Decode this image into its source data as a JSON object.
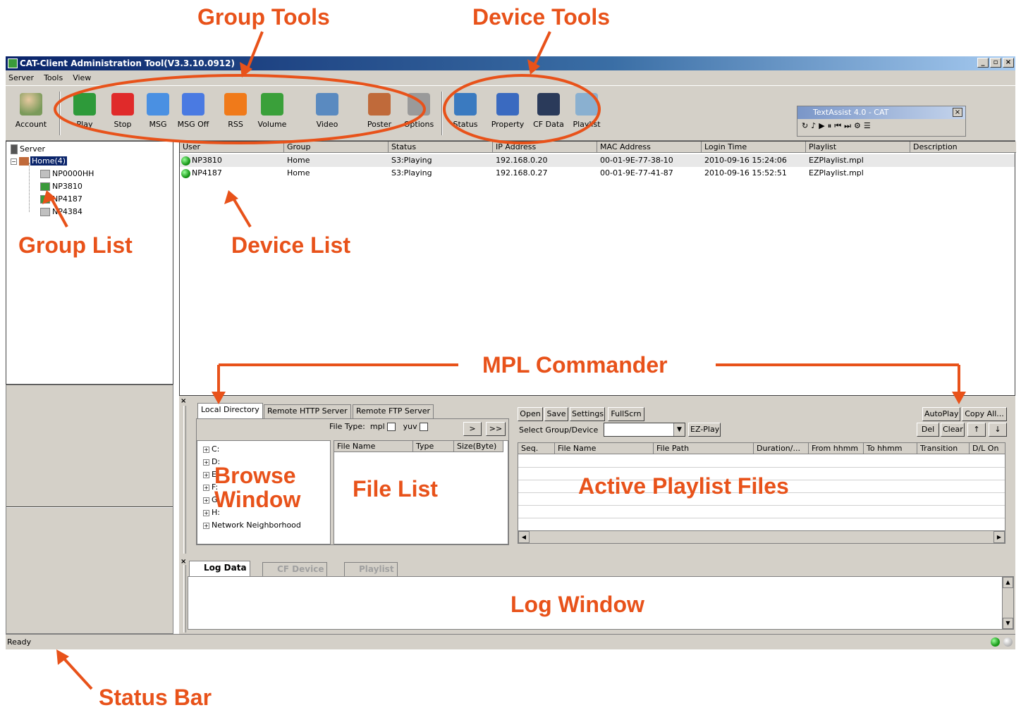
{
  "window": {
    "title": "CAT-Client Administration Tool(V3.3.10.0912)"
  },
  "menu": [
    "Server",
    "Tools",
    "View"
  ],
  "toolbar": {
    "group_tools": [
      {
        "label": "Play",
        "icon": "play-icon",
        "color": "#2e9a3a"
      },
      {
        "label": "Stop",
        "icon": "stop-icon",
        "color": "#e02a2a"
      },
      {
        "label": "MSG",
        "icon": "msg-icon",
        "color": "#4a90e2"
      },
      {
        "label": "MSG Off",
        "icon": "msg-off-icon",
        "color": "#4a7ae2"
      },
      {
        "label": "RSS",
        "icon": "rss-icon",
        "color": "#f07a1a"
      },
      {
        "label": "Volume",
        "icon": "volume-icon",
        "color": "#3aa03a"
      },
      {
        "label": "Video",
        "icon": "video-icon",
        "color": "#5a8ac0"
      },
      {
        "label": "Poster",
        "icon": "poster-icon",
        "color": "#c06a3a"
      },
      {
        "label": "Options",
        "icon": "options-gear-icon",
        "color": "#9a9a9a"
      }
    ],
    "account_label": "Account",
    "device_tools": [
      {
        "label": "Status",
        "icon": "status-icon",
        "color": "#3a7ac0"
      },
      {
        "label": "Property",
        "icon": "property-icon",
        "color": "#3a6ac0"
      },
      {
        "label": "CF Data",
        "icon": "cf-data-icon",
        "color": "#2a3a5a"
      },
      {
        "label": "Playlist",
        "icon": "playlist-icon",
        "color": "#8ab0d0"
      }
    ]
  },
  "textassist": {
    "title": "TextAssist 4.0 - CAT"
  },
  "tree": {
    "root": "Server",
    "group": "Home(4)",
    "devices": [
      "NP0000HH",
      "NP3810",
      "NP4187",
      "NP4384"
    ]
  },
  "device_list": {
    "columns": [
      "User",
      "Group",
      "Status",
      "IP Address",
      "MAC Address",
      "Login Time",
      "Playlist",
      "Description"
    ],
    "rows": [
      {
        "user": "NP3810",
        "group": "Home",
        "status": "S3:Playing",
        "ip": "192.168.0.20",
        "mac": "00-01-9E-77-38-10",
        "login": "2010-09-16 15:24:06",
        "playlist": "EZPlaylist.mpl",
        "description": ""
      },
      {
        "user": "NP4187",
        "group": "Home",
        "status": "S3:Playing",
        "ip": "192.168.0.27",
        "mac": "00-01-9E-77-41-87",
        "login": "2010-09-16 15:52:51",
        "playlist": "EZPlaylist.mpl",
        "description": ""
      }
    ]
  },
  "mpl": {
    "tabs": [
      "Local Directory",
      "Remote HTTP Server",
      "Remote FTP Server"
    ],
    "file_type_label": "File Type:",
    "mpl_label": "mpl",
    "yuv_label": "yuv",
    "btn_next": ">",
    "btn_next_all": ">>",
    "drives": [
      "C:",
      "D:",
      "E:",
      "F:",
      "G:",
      "H:",
      "Network Neighborhood"
    ],
    "file_columns": [
      "File Name",
      "Type",
      "Size(Byte)"
    ],
    "buttons": [
      "Open",
      "Save",
      "Settings",
      "FullScrn"
    ],
    "select_label": "Select Group/Device",
    "ez_play": "EZ-Play",
    "right_buttons": [
      "AutoPlay",
      "Copy All..."
    ],
    "right_buttons2": [
      "Del",
      "Clear",
      "↑",
      "↓"
    ],
    "playlist_columns": [
      "Seq.",
      "File Name",
      "File Path",
      "Duration/...",
      "From hhmm",
      "To hhmm",
      "Transition",
      "D/L On"
    ]
  },
  "log": {
    "tabs": [
      "Log Data",
      "CF Device",
      "Playlist"
    ]
  },
  "status": {
    "text": "Ready"
  },
  "callouts": {
    "group_tools": "Group Tools",
    "device_tools": "Device Tools",
    "group_list": "Group List",
    "device_list": "Device List",
    "mpl_commander": "MPL Commander",
    "browse_window": "Browse\nWindow",
    "file_list": "File List",
    "active_playlist": "Active Playlist Files",
    "log_window": "Log Window",
    "status_bar": "Status Bar"
  }
}
